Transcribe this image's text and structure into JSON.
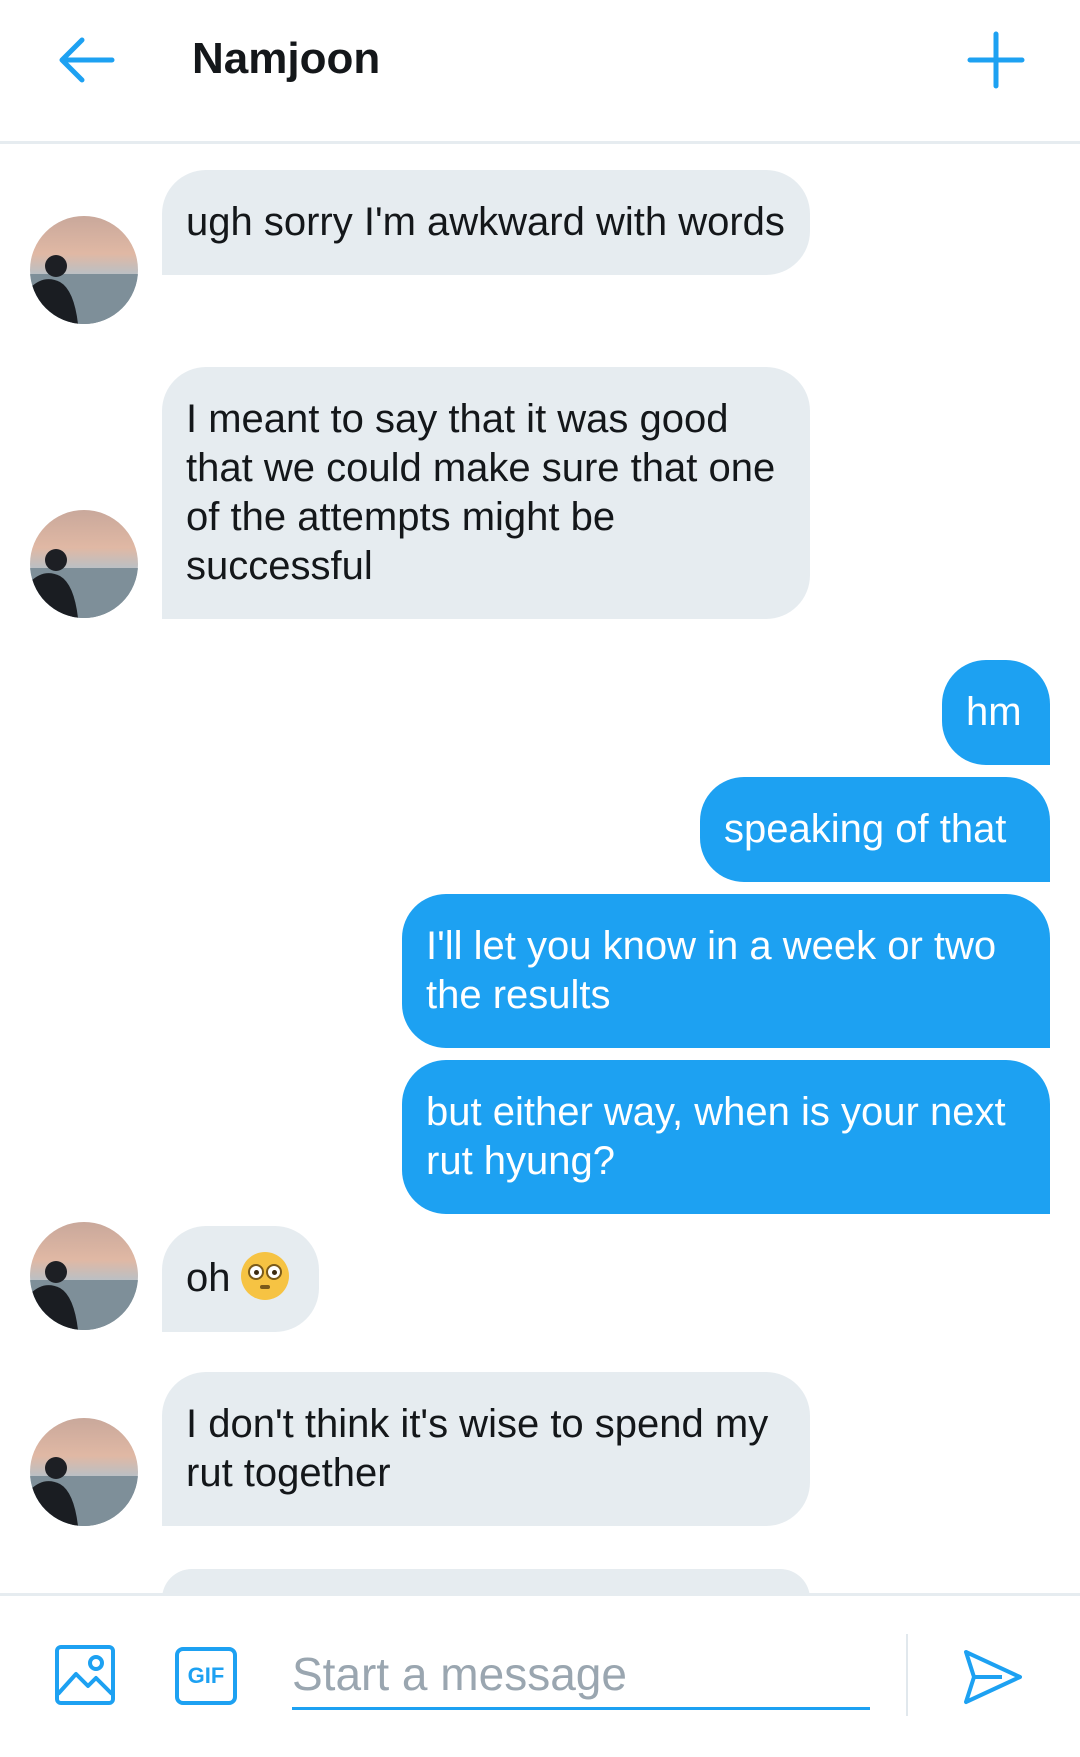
{
  "header": {
    "title": "Namjoon",
    "back_icon": "arrow-left-icon",
    "new_icon": "plus-icon",
    "accent": "#1da1f2"
  },
  "messages": [
    {
      "from": "them",
      "text": "ugh sorry I'm awkward with words"
    },
    {
      "from": "them",
      "text": "I meant to say that it was good that we could make sure that one of the attempts might be successful"
    },
    {
      "from": "me",
      "text": "hm"
    },
    {
      "from": "me",
      "text": "speaking of that"
    },
    {
      "from": "me",
      "text": "I'll let you know in a week or two the results"
    },
    {
      "from": "me",
      "text": "but either way, when is your next rut hyung?"
    },
    {
      "from": "them",
      "text": "oh",
      "emoji": "flushed-face-icon"
    },
    {
      "from": "them",
      "text": "I don't think it's wise to spend my rut together"
    }
  ],
  "composer": {
    "placeholder": "Start a message",
    "image_icon": "image-icon",
    "gif_label": "GIF",
    "send_icon": "send-icon"
  },
  "colors": {
    "incoming_bubble": "#e6ecf0",
    "outgoing_bubble": "#1da1f2",
    "text_dark": "#14171a"
  }
}
